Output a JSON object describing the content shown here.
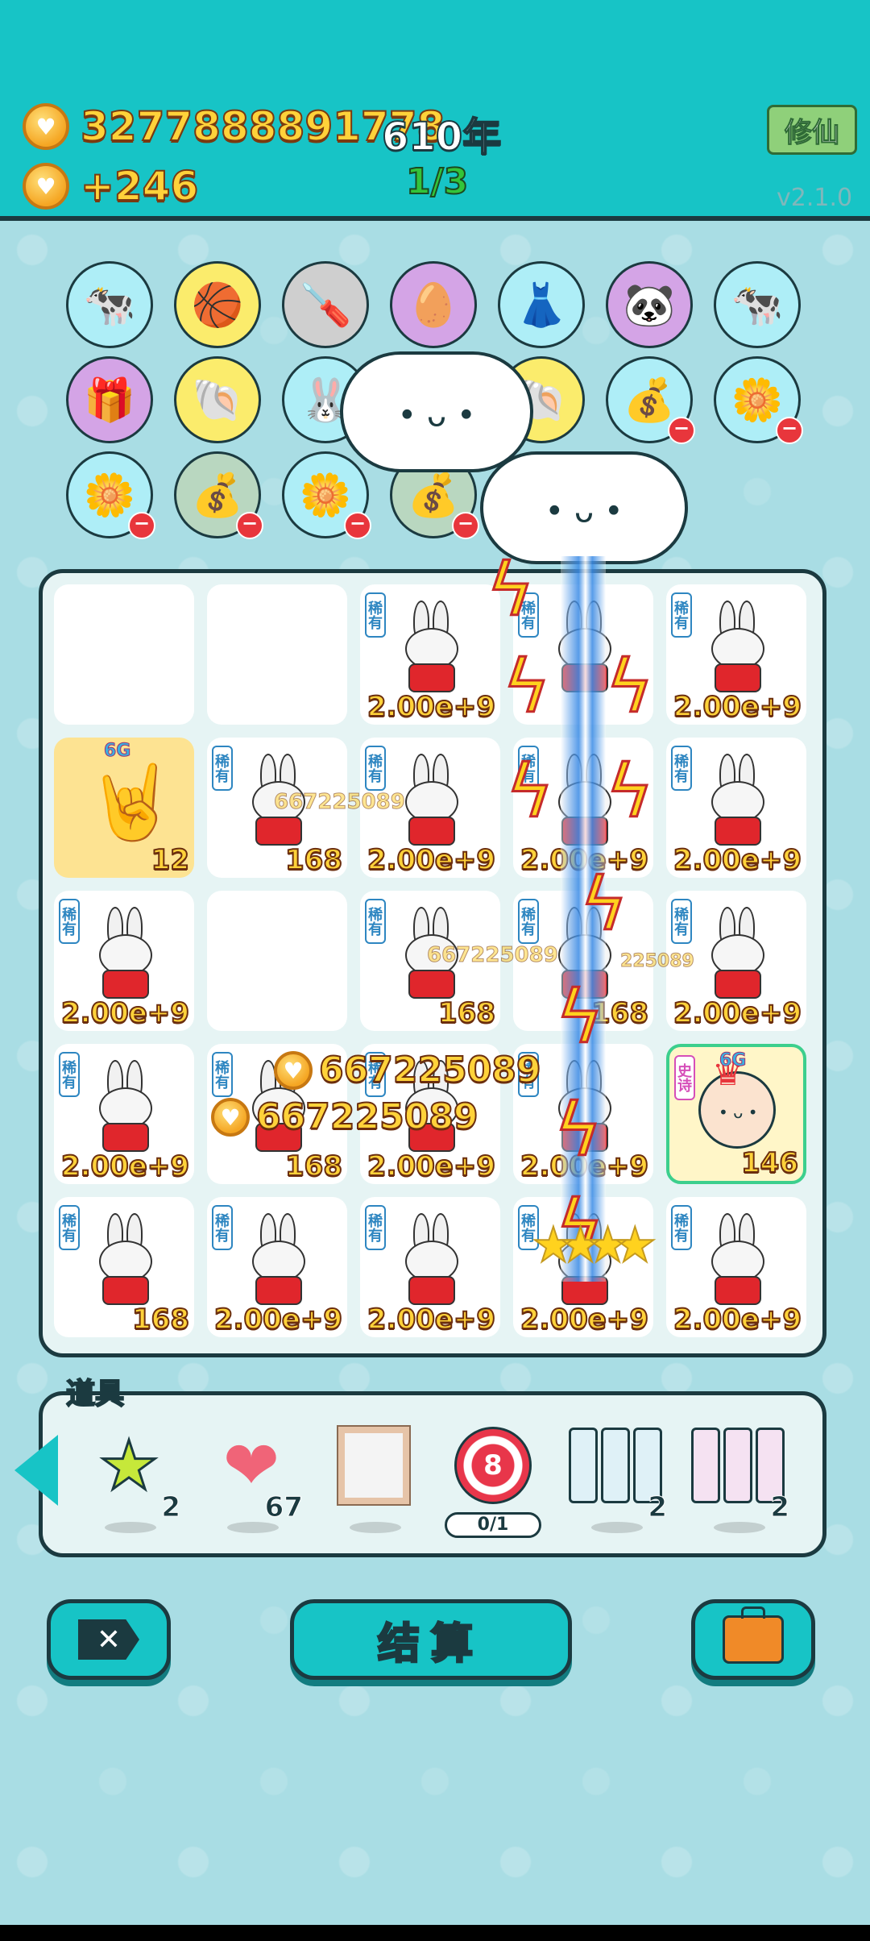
{
  "header": {
    "coins_total": "3277888891778",
    "years": "610年",
    "income_rate": "+246",
    "progress": "1/3",
    "xiuxian_label": "修仙",
    "version": "v2.1.0"
  },
  "inventory": {
    "row1": [
      "cow-icon",
      "basketball-icon",
      "screwdriver-icon",
      "egg-icon",
      "skirt-icon",
      "panda-icon",
      "cow-icon"
    ],
    "row2": [
      "gift-box-icon",
      "shell-icon",
      "bunny-icon",
      "",
      "shell-icon",
      "money-bag-icon",
      "flower-pot-icon"
    ],
    "row3": [
      "flower-pot-icon",
      "money-bag-icon",
      "flower-pot-icon",
      "money-bag-icon"
    ]
  },
  "board": {
    "rare_tag": "稀有",
    "epic_tag": "史诗",
    "cells": [
      {
        "item": "",
        "value": ""
      },
      {
        "item": "",
        "value": ""
      },
      {
        "item": "bunny",
        "value": "2.00e+9"
      },
      {
        "item": "bunny",
        "value": ""
      },
      {
        "item": "bunny",
        "value": "2.00e+9"
      },
      {
        "item": "rock-hand",
        "value": "12",
        "badge": "6G"
      },
      {
        "item": "bunny",
        "value": "168"
      },
      {
        "item": "bunny",
        "value": "2.00e+9"
      },
      {
        "item": "bunny",
        "value": "2.00e+9"
      },
      {
        "item": "bunny",
        "value": "2.00e+9"
      },
      {
        "item": "bunny",
        "value": "2.00e+9"
      },
      {
        "item": "",
        "value": ""
      },
      {
        "item": "bunny",
        "value": "168"
      },
      {
        "item": "bunny",
        "value": "168"
      },
      {
        "item": "bunny",
        "value": "2.00e+9"
      },
      {
        "item": "bunny",
        "value": "2.00e+9"
      },
      {
        "item": "bunny",
        "value": "168"
      },
      {
        "item": "bunny",
        "value": "2.00e+9"
      },
      {
        "item": "bunny",
        "value": "2.00e+9"
      },
      {
        "item": "king",
        "value": "146",
        "badge": "6G"
      },
      {
        "item": "bunny",
        "value": "168"
      },
      {
        "item": "bunny",
        "value": "2.00e+9"
      },
      {
        "item": "bunny",
        "value": "2.00e+9"
      },
      {
        "item": "bunny",
        "value": "2.00e+9"
      },
      {
        "item": "bunny",
        "value": "2.00e+9"
      }
    ],
    "floating_rewards": [
      "667225089",
      "667225089",
      "667225089",
      "667225089",
      "225089"
    ]
  },
  "tools": {
    "label": "道具",
    "items": [
      {
        "icon": "star-icon",
        "count": "2"
      },
      {
        "icon": "liver-icon",
        "count": "67"
      },
      {
        "icon": "frame-icon",
        "count": ""
      },
      {
        "icon": "target-icon",
        "count": "",
        "number": "8",
        "progress": "0/1"
      },
      {
        "icon": "rare-cards-icon",
        "count": "2"
      },
      {
        "icon": "epic-cards-icon",
        "count": "2"
      }
    ]
  },
  "buttons": {
    "settle_label": "结算"
  },
  "colors": {
    "header": "#17c4c6",
    "background": "#a9dde4",
    "gold": "#ffd23a",
    "outline": "#1b3a40"
  }
}
